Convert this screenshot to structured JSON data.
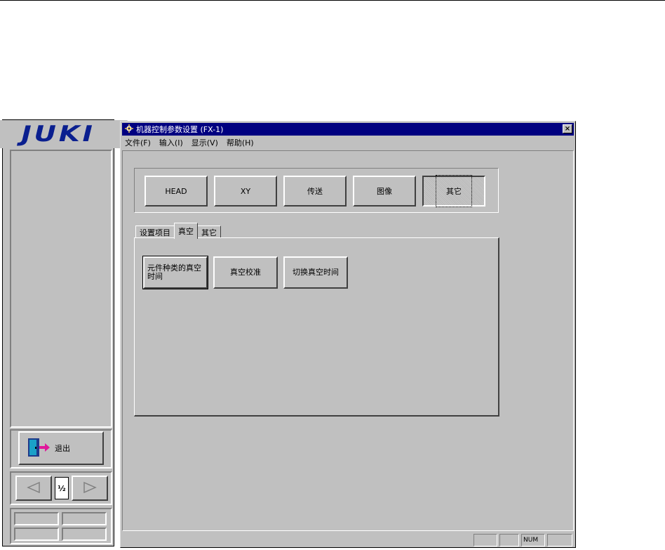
{
  "juki_panel": {
    "logo": "JUKI",
    "exit_label": "退出",
    "page_indicator": "½"
  },
  "window": {
    "title": "机器控制参数设置 (FX-1)",
    "close_glyph": "×"
  },
  "menu": [
    {
      "label": "文件(F)"
    },
    {
      "label": "输入(I)"
    },
    {
      "label": "显示(V)"
    },
    {
      "label": "帮助(H)"
    }
  ],
  "groups": [
    {
      "label": "HEAD"
    },
    {
      "label": "XY"
    },
    {
      "label": "传送"
    },
    {
      "label": "图像"
    },
    {
      "label": "其它",
      "active": true
    }
  ],
  "tabs": [
    {
      "label": "设置项目"
    },
    {
      "label": "真空",
      "selected": true
    },
    {
      "label": "其它"
    }
  ],
  "panel_buttons": [
    {
      "label": "元件种类的真空时间"
    },
    {
      "label": "真空校准"
    },
    {
      "label": "切换真空时间"
    }
  ],
  "status": {
    "pane1": "",
    "pane2": "",
    "num": "NUM",
    "pane4": ""
  },
  "colors": {
    "face": "#c0c0c0",
    "titlebar": "#000080",
    "logo": "#0a1f8f",
    "exit_accent": "#e0179a"
  }
}
